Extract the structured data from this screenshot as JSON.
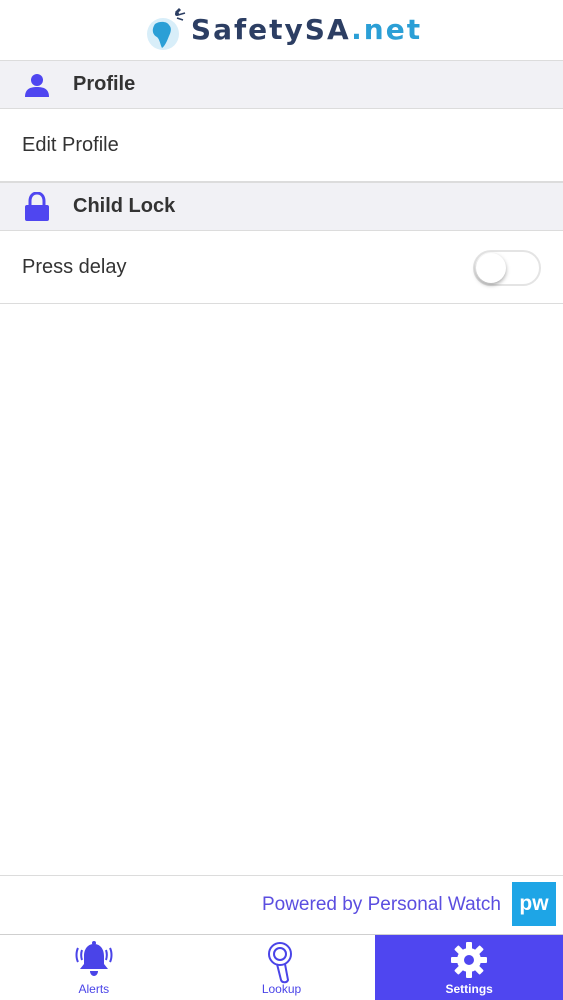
{
  "header": {
    "brand": "SafetySA",
    "tld": ".net"
  },
  "sections": [
    {
      "title": "Profile",
      "icon": "person-icon",
      "row_label": "Edit Profile"
    },
    {
      "title": "Child Lock",
      "icon": "lock-icon",
      "row_label": "Press delay",
      "toggle_on": false
    }
  ],
  "footer": {
    "powered_text": "Powered by Personal Watch",
    "badge": "pw"
  },
  "tabs": [
    {
      "label": "Alerts",
      "icon": "bell-icon",
      "active": false
    },
    {
      "label": "Lookup",
      "icon": "search-key-icon",
      "active": false
    },
    {
      "label": "Settings",
      "icon": "gear-icon",
      "active": true
    }
  ],
  "colors": {
    "accent": "#4f46f0",
    "brand_dark": "#2c3e63",
    "brand_blue": "#2b9fd6",
    "badge": "#1ea5e6"
  }
}
